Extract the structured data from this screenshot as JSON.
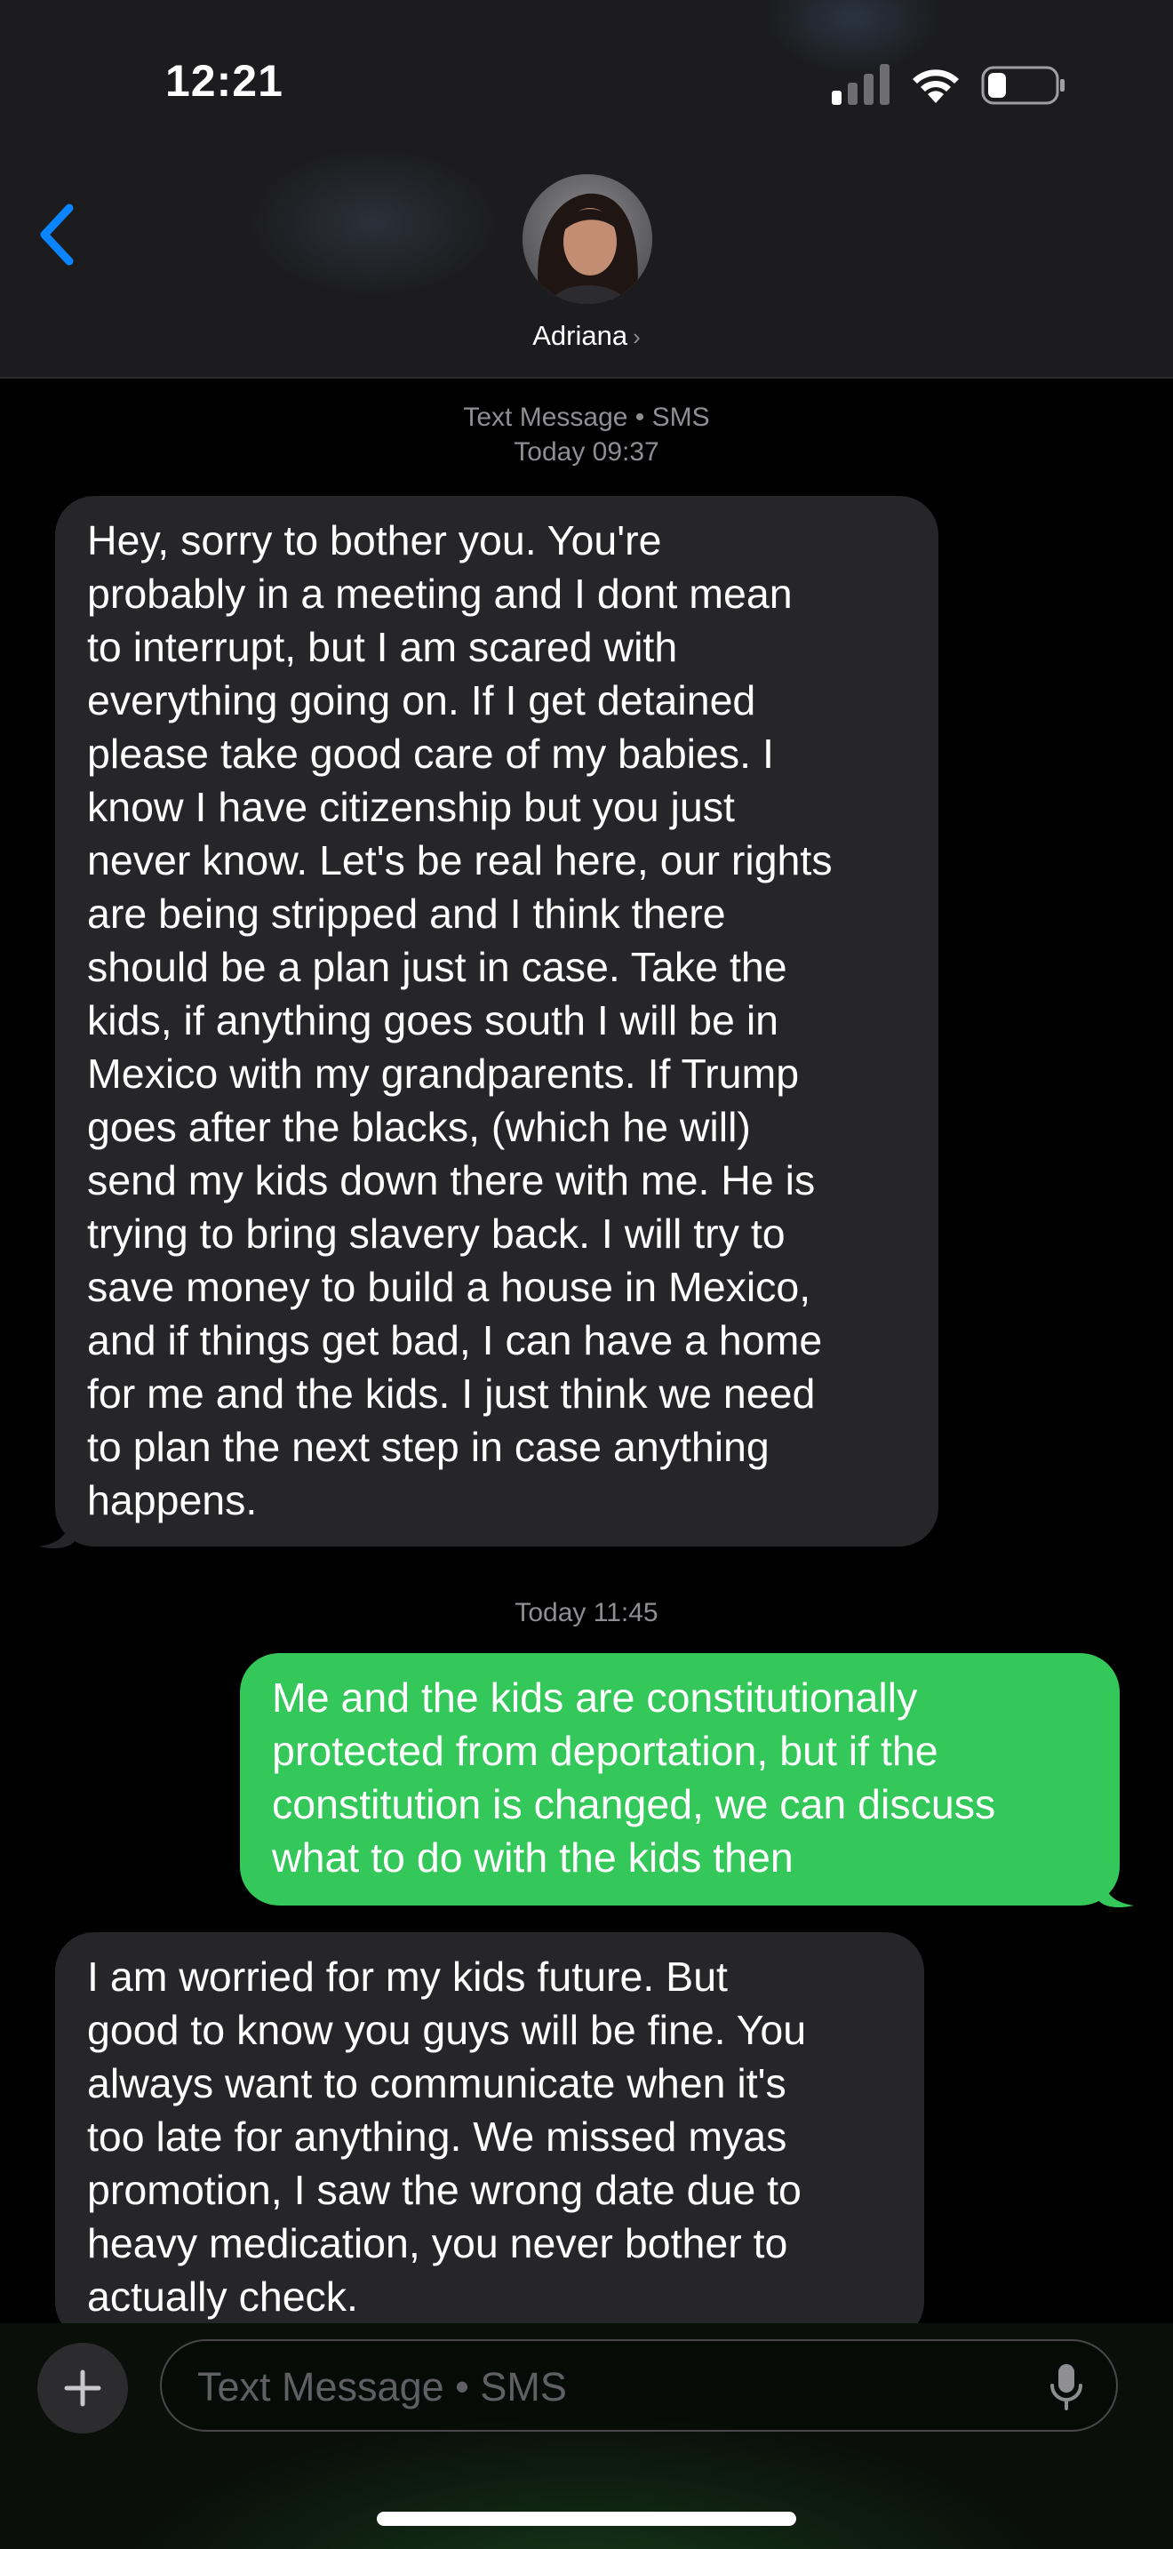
{
  "status_bar": {
    "time": "12:21",
    "icons": [
      "cellular-signal-icon",
      "wifi-icon",
      "battery-icon"
    ]
  },
  "header": {
    "back_icon": "chevron-left-icon",
    "contact_name": "Adriana",
    "contact_chevron": "›"
  },
  "thread": {
    "header_service": "Text Message • SMS",
    "header_timestamp": "Today 09:37",
    "messages": [
      {
        "direction": "incoming",
        "text": "Hey, sorry to bother you. You're\nprobably in a meeting and I dont mean\nto interrupt, but I am scared with\neverything going on. If I get detained\nplease take good care of my babies. I\nknow I have citizenship but you just\nnever know. Let's be real here, our rights\nare being stripped and I think there\nshould be a plan just in case. Take the\nkids, if anything goes south I will be in\nMexico with my grandparents. If Trump\ngoes after the blacks, (which he will)\nsend my kids down there with me. He is\ntrying to bring slavery back. I will try to\nsave money to build a house in Mexico,\nand if things get bad, I can have a home\nfor me and the kids. I just think we need\nto plan the next step in case anything\nhappens."
      },
      {
        "direction": "outgoing",
        "text": "Me and the kids are constitutionally\nprotected from deportation, but if the\nconstitution is changed, we can discuss\nwhat to do with the kids then"
      },
      {
        "direction": "incoming",
        "text": "I am worried for my kids future. But\ngood to know you guys will be fine. You\nalways want to communicate when it's\ntoo late for anything. We missed myas\npromotion, I saw the wrong date due to\nheavy medication, you never bother to\nactually check."
      }
    ],
    "second_timestamp": "Today 11:45"
  },
  "composer": {
    "placeholder": "Text Message • SMS",
    "plus_icon": "plus-icon",
    "mic_icon": "microphone-icon"
  },
  "colors": {
    "outgoing_bubble": "#34c759",
    "incoming_bubble": "#262629",
    "accent_blue": "#0a84ff",
    "header_bg": "#1c1c1e"
  }
}
